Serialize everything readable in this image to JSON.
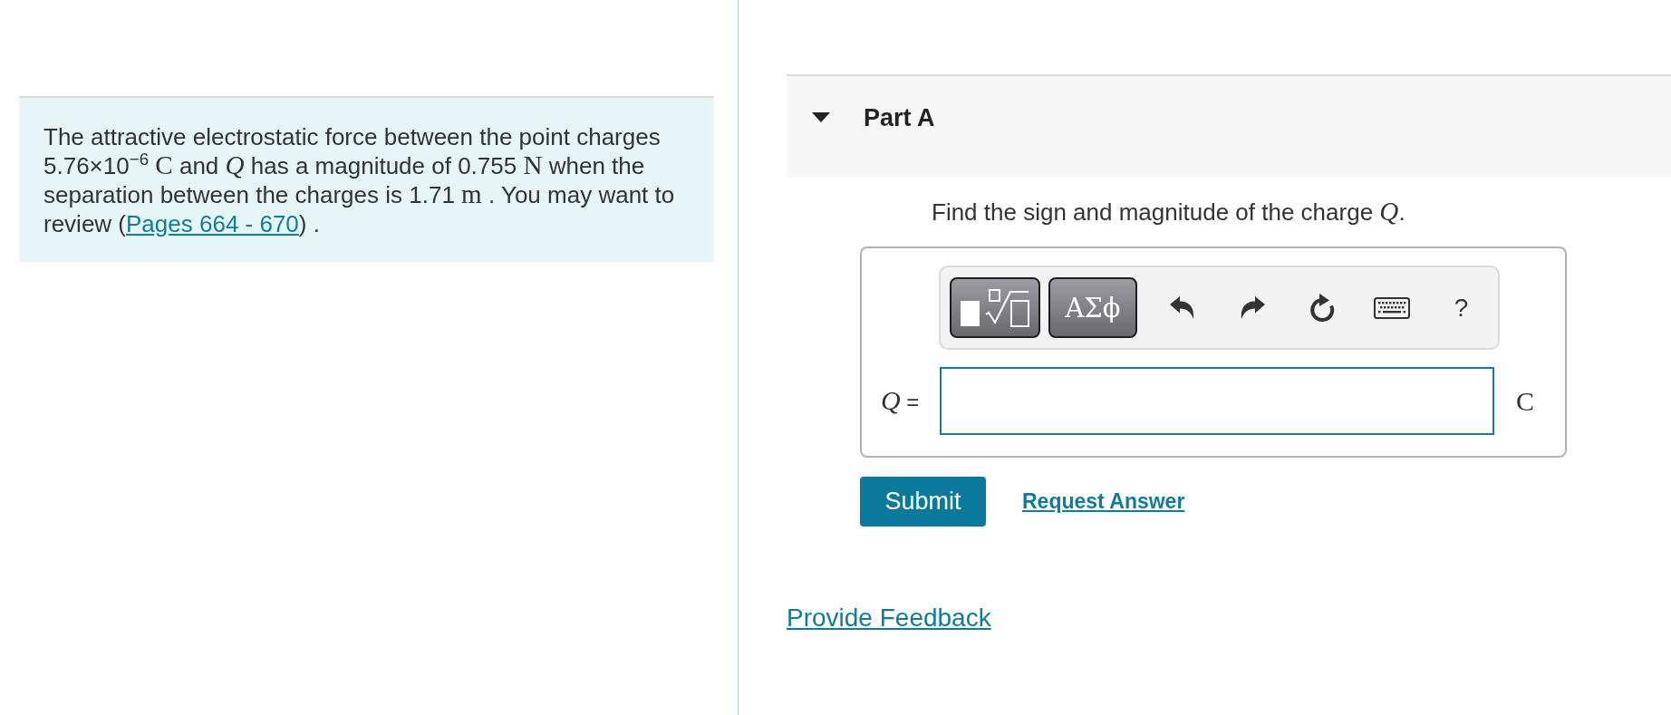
{
  "problem": {
    "segments": [
      {
        "kind": "text",
        "text": "The attractive electrostatic force between the point charges 5.76×10$^{−6}$ "
      },
      {
        "kind": "math",
        "text": "C"
      },
      {
        "kind": "text",
        "text": " and "
      },
      {
        "kind": "math",
        "text": "*Q*"
      },
      {
        "kind": "text",
        "text": " has a magnitude of 0.755 "
      },
      {
        "kind": "math",
        "text": "N"
      },
      {
        "kind": "text",
        "text": " when the separation between the charges is 1.71 "
      },
      {
        "kind": "math",
        "text": "m"
      },
      {
        "kind": "text",
        "text": " . You may want to review ("
      },
      {
        "kind": "link",
        "text": "Pages 664 - 670"
      },
      {
        "kind": "text",
        "text": ") ."
      }
    ]
  },
  "part": {
    "label": "Part A",
    "expanded": true,
    "question": {
      "segments": [
        {
          "kind": "text",
          "text": "Find the sign and magnitude of the charge "
        },
        {
          "kind": "math",
          "text": "*Q*"
        },
        {
          "kind": "text",
          "text": "."
        }
      ]
    },
    "toolbar": [
      {
        "kind": "template"
      },
      {
        "kind": "symbols",
        "label": "ΑΣϕ"
      },
      {
        "kind": "undo"
      },
      {
        "kind": "redo"
      },
      {
        "kind": "reset"
      },
      {
        "kind": "keyboard"
      },
      {
        "kind": "help",
        "label": "?"
      }
    ],
    "answer": {
      "label": [
        {
          "kind": "math",
          "text": "*Q*"
        },
        {
          "kind": "text",
          "text": " ="
        }
      ],
      "unit": "C"
    },
    "actions": [
      {
        "kind": "primary",
        "label": "Submit"
      },
      {
        "kind": "link",
        "label": "Request Answer"
      }
    ]
  },
  "feedback": {
    "label": "Provide Feedback"
  }
}
